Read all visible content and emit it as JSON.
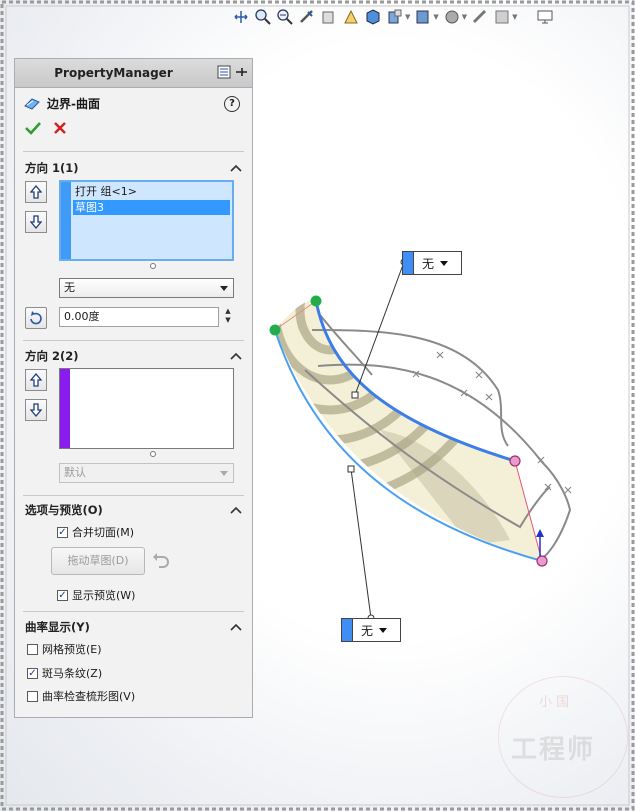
{
  "toolbar": {
    "icons": [
      "zoom-to-fit-icon",
      "zoom-area-icon",
      "previous-view-icon",
      "section-view-icon",
      "dynamic-annotation-icon",
      "view-orientation-icon",
      "display-style-icon",
      "hide-show-icon",
      "edit-appearance-icon",
      "apply-scene-icon",
      "view-settings-icon",
      "monitor-icon"
    ]
  },
  "panel": {
    "title": "PropertyManager",
    "feature_name": "边界-曲面",
    "help": "?",
    "direction1": {
      "title": "方向 1(1)",
      "items": [
        "打开 组<1>",
        "草图3"
      ],
      "selected_index": 1,
      "combo": "无",
      "angle": "0.00度",
      "stripe_color": "#3f9bf5"
    },
    "direction2": {
      "title": "方向 2(2)",
      "items": [],
      "combo": "默认",
      "stripe_color": "#8a1cf0"
    },
    "options": {
      "title": "选项与预览(O)",
      "merge_label": "合并切面(M)",
      "merge_checked": true,
      "drag_sketch_label": "拖动草图(D)",
      "preview_label": "显示预览(W)",
      "preview_checked": true
    },
    "curvature": {
      "title": "曲率显示(Y)",
      "mesh_label": "网格预览(E)",
      "mesh_checked": false,
      "zebra_label": "斑马条纹(Z)",
      "zebra_checked": true,
      "comb_label": "曲率检查梳形图(V)",
      "comb_checked": false
    }
  },
  "callouts": {
    "top": "无",
    "bottom": "无"
  },
  "watermark": {
    "text": "工程师",
    "small": "小 国"
  },
  "colors": {
    "accent": "#3f8ef5",
    "selection": "#3399ff",
    "dir2": "#8a1cf0",
    "ok": "#2e9e2e",
    "cancel": "#d21f1f"
  }
}
